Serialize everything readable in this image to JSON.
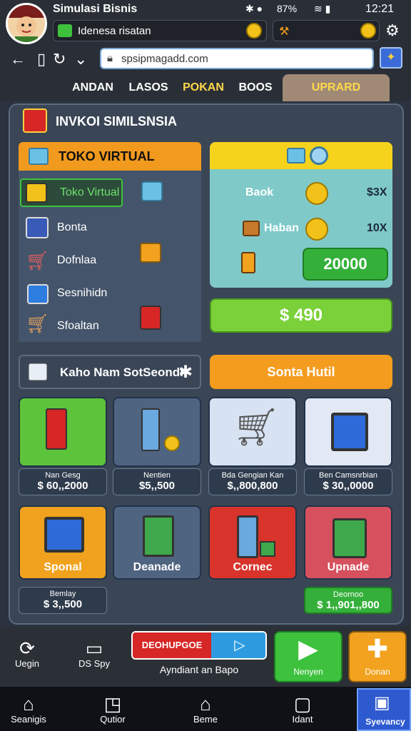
{
  "status": {
    "app_title": "Simulasi Bisnis",
    "time": "12:21",
    "signal_text": "87%",
    "chip1_text": "Idenesa risatan"
  },
  "address": {
    "url": "spsipmagadd.com"
  },
  "tabs": [
    "ANDAN",
    "LASOS",
    "POKAN",
    "BOOS",
    "UPRARD"
  ],
  "panel": {
    "title": "INVKOI SIMILSNSIA"
  },
  "left": {
    "header": "TOKO VIRTUAL",
    "items": [
      "Toko Virtual",
      "Bonta",
      "Dofnlaa",
      "Sesnihidn",
      "Sfoaltan"
    ]
  },
  "right": {
    "rows": [
      {
        "label": "Baok",
        "value": "$3X"
      },
      {
        "label": "Haban",
        "value": "10X"
      }
    ],
    "green_value": "20000",
    "price": "$ 490"
  },
  "mid": {
    "bar_label": "Kaho Nam SotSeondl",
    "orange_label": "Sonta Hutil"
  },
  "products": [
    {
      "name": "Nan Gesg",
      "price": "$ 60,,2000",
      "color": "#5cc43a"
    },
    {
      "name": "Nentien",
      "price": "$5,,500",
      "color": "#4f6480"
    },
    {
      "name": "Bda Gengian Kan",
      "price": "$,,800,800",
      "color": "#d7e2f2"
    },
    {
      "name": "Ben Camsnrbian",
      "price": "$ 30,,0000",
      "color": "#e2e8f4"
    }
  ],
  "big_cards": [
    {
      "label": "Sponal",
      "color": "#f0a21e"
    },
    {
      "label": "Deanade",
      "color": "#4f6480"
    },
    {
      "label": "Cornec",
      "color": "#d8342b"
    },
    {
      "label": "Upnade",
      "color": "#d6505e"
    }
  ],
  "small_labels": [
    {
      "name": "Bemlay",
      "price": "$ 3,,500"
    },
    {
      "name": "Deornoo",
      "price": "$ 1,,901,,800"
    }
  ],
  "bottom": {
    "left1": "Uegin",
    "left2": "DS Spy",
    "promo": "DEOHUPGOE",
    "promo_sub": "Ayndiant an Bapo",
    "play": "Nenyen",
    "plus": "Donan"
  },
  "sysnav": [
    "Seanigis",
    "Qutior",
    "Beme",
    "Idant",
    "Syevancy"
  ]
}
